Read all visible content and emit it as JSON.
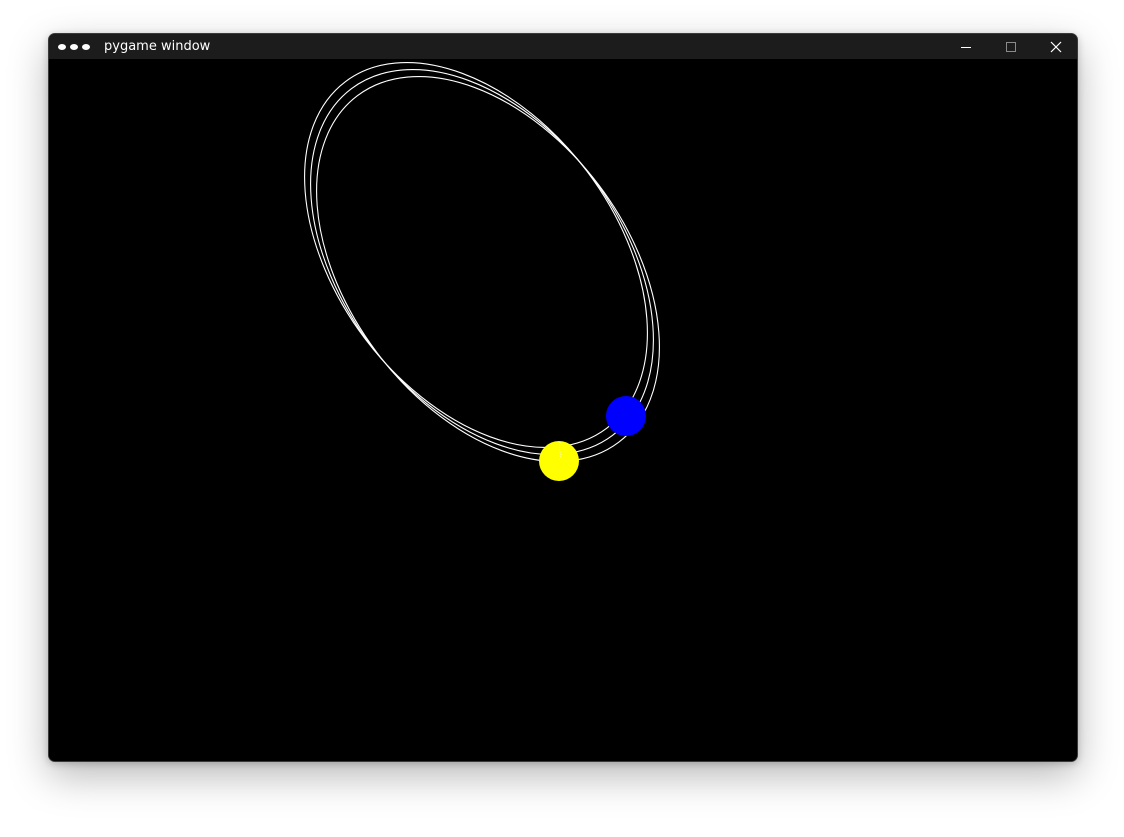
{
  "window": {
    "title": "pygame window",
    "icons": {
      "app": "dots-icon",
      "minimize": "minimize-icon",
      "maximize": "maximize-icon",
      "close": "close-icon"
    }
  },
  "scene": {
    "background_color": "#000000",
    "orbit_color": "#ffffff",
    "sun_color": "#ffff00",
    "planet_color": "#0000ff"
  }
}
